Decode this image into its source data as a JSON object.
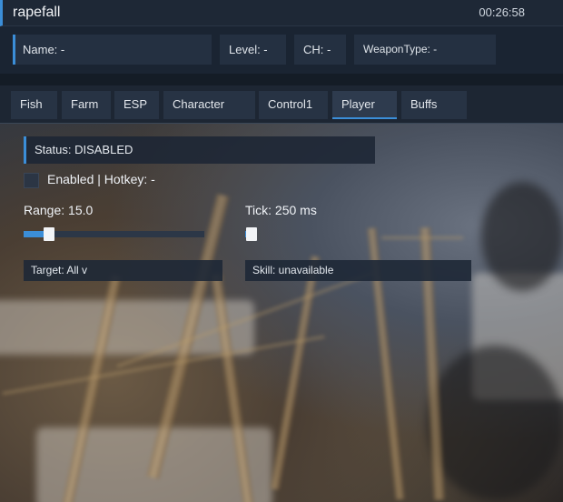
{
  "window": {
    "title": "rapefall",
    "clock": "00:26:58"
  },
  "info": {
    "name": "Name: -",
    "level": "Level: -",
    "ch": "CH: -",
    "weapon_type": "WeaponType: -"
  },
  "tabs": [
    {
      "label": "Fish",
      "active": false
    },
    {
      "label": "Farm",
      "active": false
    },
    {
      "label": "ESP",
      "active": false
    },
    {
      "label": "Character",
      "active": false
    },
    {
      "label": "Control1",
      "active": false
    },
    {
      "label": "Player",
      "active": true
    },
    {
      "label": "Buffs",
      "active": false
    }
  ],
  "player": {
    "status": "Status: DISABLED",
    "enabled_label": "Enabled | Hotkey: -",
    "enabled": false,
    "range": {
      "label": "Range: 15.0",
      "fill_fraction": 0.13
    },
    "tick": {
      "label": "Tick: 250 ms",
      "fill_fraction": 0.02
    },
    "target_dropdown": "Target: All  v",
    "skill_dropdown": "Skill: unavailable"
  },
  "colors": {
    "accent": "#3b8ed8",
    "panel": "#1d2633"
  }
}
